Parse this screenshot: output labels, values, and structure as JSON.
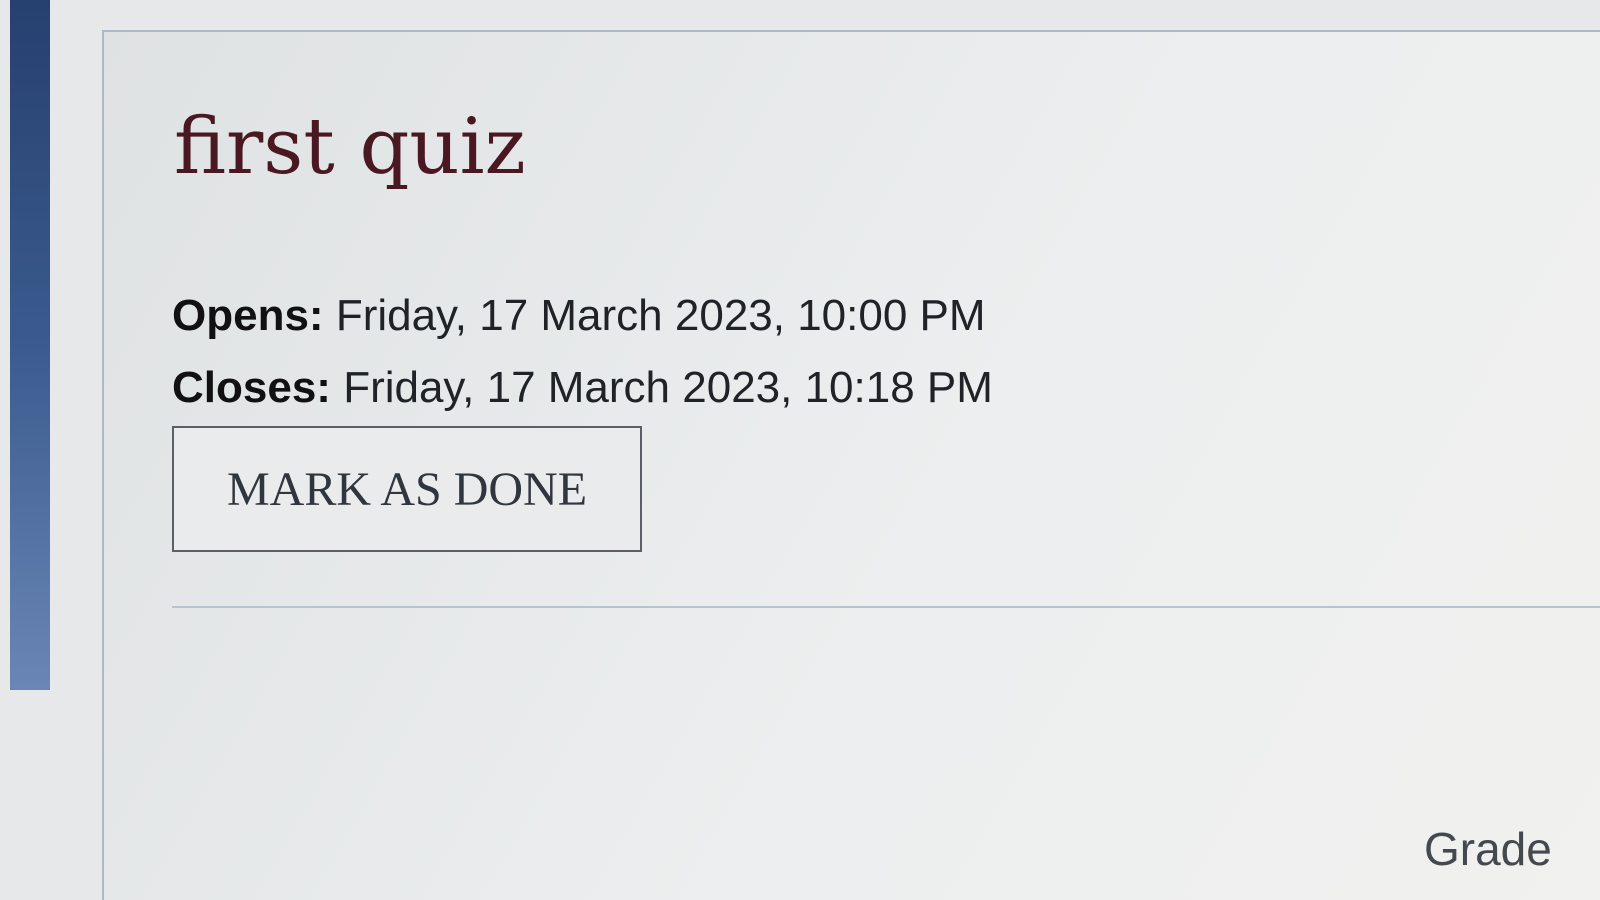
{
  "activity": {
    "title": "first quiz",
    "opens_label": "Opens:",
    "opens_value": "Friday, 17 March 2023, 10:00 PM",
    "closes_label": "Closes:",
    "closes_value": "Friday, 17 March 2023, 10:18 PM",
    "mark_done_label": "MARK AS DONE"
  },
  "footer": {
    "grade_label": "Grade"
  },
  "colors": {
    "title": "#4a1822",
    "sidebar_accent": "#2f4a7a",
    "divider": "#b9c3d0"
  }
}
